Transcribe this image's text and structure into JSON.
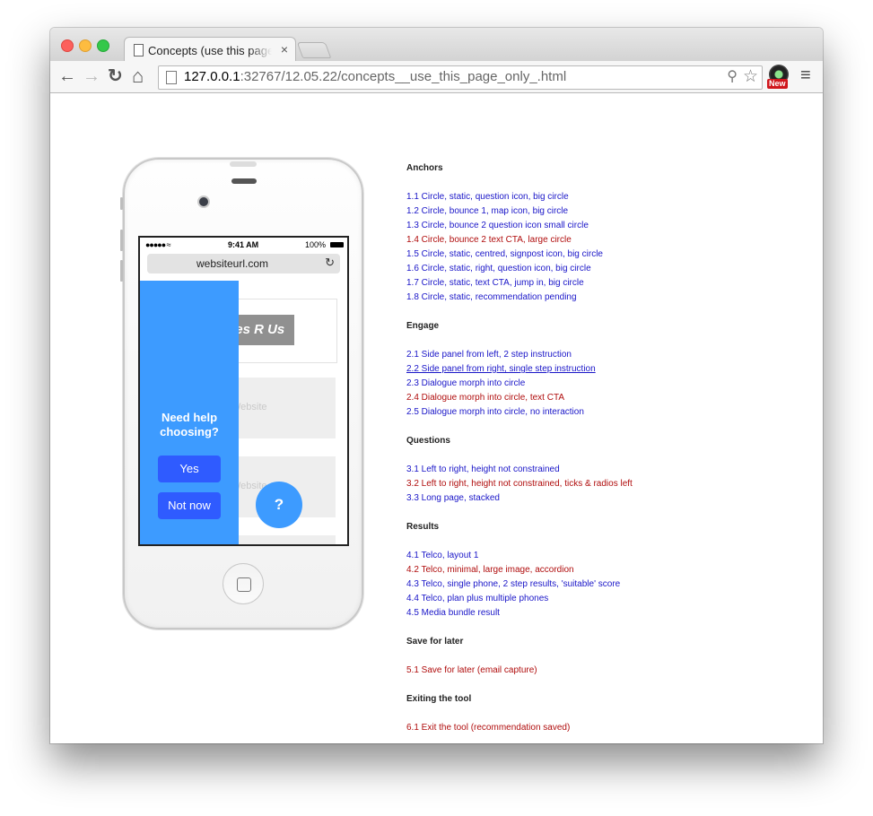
{
  "browser": {
    "tab_title": "Concepts (use this page only).html",
    "tab_close": "×",
    "nav": {
      "back": "←",
      "forward": "→",
      "reload": "↻",
      "home": "⌂"
    },
    "url_host": "127.0.0.1",
    "url_rest": ":32767/12.05.22/concepts__use_this_page_only_.html",
    "extension_badge": "New",
    "menu": "≡",
    "icons": [
      "page-icon",
      "zoom-icon",
      "bookmark-star-icon",
      "extension-icon",
      "menu-icon"
    ]
  },
  "phone": {
    "status_signal": "●●●●● ≈",
    "status_time": "9:41 AM",
    "status_battery": "100%",
    "address": "websiteurl.com",
    "reload": "↻",
    "logo": "Phones R Us",
    "block_text_1": "Website",
    "block_text_2": "Website",
    "panel_heading": "Need help choosing?",
    "yes_label": "Yes",
    "notnow_label": "Not now",
    "fab_label": "?"
  },
  "colors": {
    "panel": "#3d9bff",
    "panel_button": "#2f5bff",
    "link_blue": "#1a16c8",
    "link_red": "#b00d0d"
  },
  "sections": [
    {
      "title": "Anchors",
      "links": [
        {
          "text": "1.1 Circle, static, question icon, big circle",
          "color": "blue"
        },
        {
          "text": "1.2 Circle, bounce 1, map icon, big circle",
          "color": "blue"
        },
        {
          "text": "1.3 Circle, bounce 2 question icon small circle",
          "color": "blue"
        },
        {
          "text": "1.4 Circle, bounce 2 text CTA, large circle",
          "color": "red"
        },
        {
          "text": "1.5 Circle, static, centred, signpost icon, big circle",
          "color": "blue"
        },
        {
          "text": "1.6 Circle, static, right, question icon, big circle",
          "color": "blue"
        },
        {
          "text": "1.7 Circle, static, text CTA, jump in, big circle",
          "color": "blue"
        },
        {
          "text": "1.8 Circle, static, recommendation pending",
          "color": "blue"
        }
      ]
    },
    {
      "title": "Engage",
      "links": [
        {
          "text": "2.1 Side panel from left, 2 step instruction",
          "color": "blue"
        },
        {
          "text": "2.2 Side panel from right, single step instruction",
          "color": "blue",
          "underline": true
        },
        {
          "text": "2.3 Dialogue morph into circle",
          "color": "blue"
        },
        {
          "text": "2.4 Dialogue morph into circle, text CTA",
          "color": "red"
        },
        {
          "text": "2.5 Dialogue morph into circle, no interaction",
          "color": "blue"
        }
      ]
    },
    {
      "title": "Questions",
      "links": [
        {
          "text": "3.1 Left to right, height not constrained",
          "color": "blue"
        },
        {
          "text": "3.2 Left to right, height not constrained, ticks & radios left",
          "color": "red"
        },
        {
          "text": "3.3 Long page, stacked",
          "color": "blue"
        }
      ]
    },
    {
      "title": "Results",
      "links": [
        {
          "text": "4.1 Telco, layout 1",
          "color": "blue"
        },
        {
          "text": "4.2 Telco, minimal, large image, accordion",
          "color": "red"
        },
        {
          "text": "4.3 Telco, single phone, 2 step results, 'suitable' score",
          "color": "blue"
        },
        {
          "text": "4.4 Telco, plan plus multiple phones",
          "color": "blue"
        },
        {
          "text": "4.5 Media bundle result",
          "color": "blue"
        }
      ]
    },
    {
      "title": "Save for later",
      "links": [
        {
          "text": "5.1 Save for later (email capture)",
          "color": "red"
        }
      ]
    },
    {
      "title": "Exiting the tool",
      "links": [
        {
          "text": "6.1 Exit the tool (recommendation saved)",
          "color": "red"
        }
      ]
    }
  ]
}
